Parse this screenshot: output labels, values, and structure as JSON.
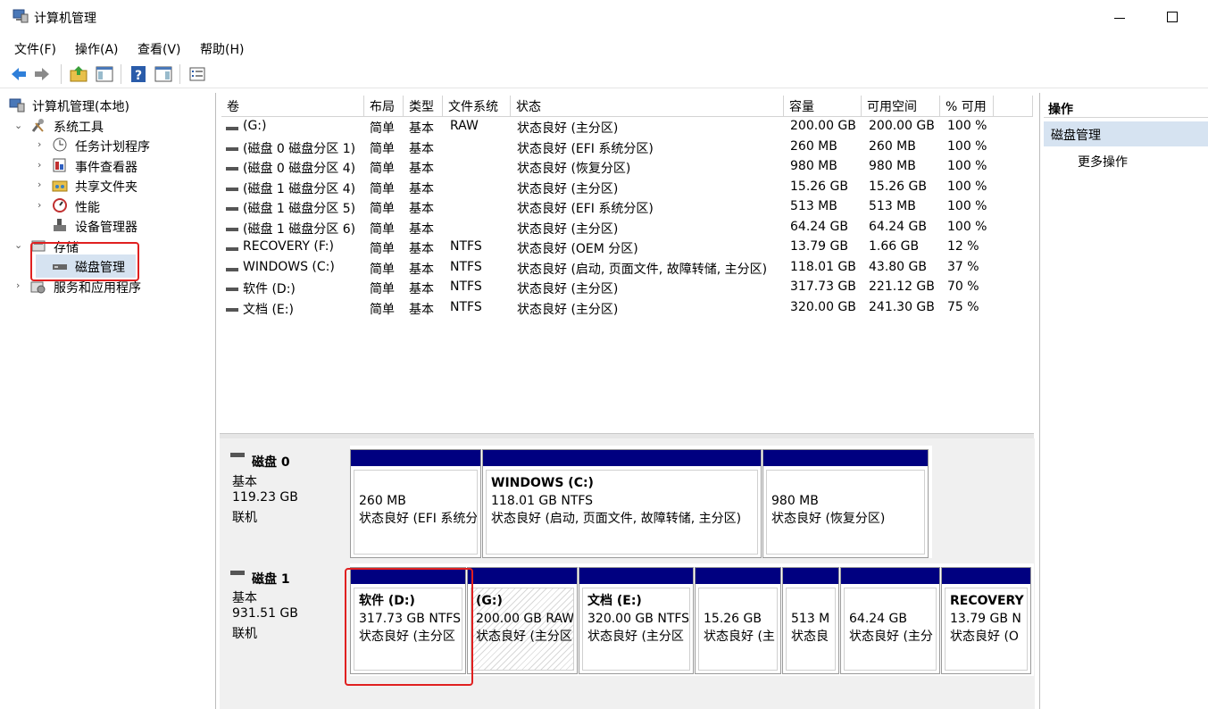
{
  "window": {
    "title": "计算机管理"
  },
  "menu": [
    "文件(F)",
    "操作(A)",
    "查看(V)",
    "帮助(H)"
  ],
  "toolbar": [
    "back-icon",
    "forward-icon",
    "up-folder-icon",
    "show-hide-tree-icon",
    "help-icon",
    "show-hide-action-pane-icon",
    "properties-icon"
  ],
  "tree": {
    "root": "计算机管理(本地)",
    "system_tools": "系统工具",
    "task_scheduler": "任务计划程序",
    "event_viewer": "事件查看器",
    "shared_folders": "共享文件夹",
    "performance": "性能",
    "device_manager": "设备管理器",
    "storage": "存储",
    "disk_management": "磁盘管理",
    "services_apps": "服务和应用程序"
  },
  "volume_table": {
    "headers": [
      "卷",
      "布局",
      "类型",
      "文件系统",
      "状态",
      "容量",
      "可用空间",
      "% 可用"
    ],
    "rows": [
      [
        "(G:)",
        "简单",
        "基本",
        "RAW",
        "状态良好 (主分区)",
        "200.00 GB",
        "200.00 GB",
        "100 %"
      ],
      [
        "(磁盘 0 磁盘分区 1)",
        "简单",
        "基本",
        "",
        "状态良好 (EFI 系统分区)",
        "260 MB",
        "260 MB",
        "100 %"
      ],
      [
        "(磁盘 0 磁盘分区 4)",
        "简单",
        "基本",
        "",
        "状态良好 (恢复分区)",
        "980 MB",
        "980 MB",
        "100 %"
      ],
      [
        "(磁盘 1 磁盘分区 4)",
        "简单",
        "基本",
        "",
        "状态良好 (主分区)",
        "15.26 GB",
        "15.26 GB",
        "100 %"
      ],
      [
        "(磁盘 1 磁盘分区 5)",
        "简单",
        "基本",
        "",
        "状态良好 (EFI 系统分区)",
        "513 MB",
        "513 MB",
        "100 %"
      ],
      [
        "(磁盘 1 磁盘分区 6)",
        "简单",
        "基本",
        "",
        "状态良好 (主分区)",
        "64.24 GB",
        "64.24 GB",
        "100 %"
      ],
      [
        "RECOVERY (F:)",
        "简单",
        "基本",
        "NTFS",
        "状态良好 (OEM 分区)",
        "13.79 GB",
        "1.66 GB",
        "12 %"
      ],
      [
        "WINDOWS (C:)",
        "简单",
        "基本",
        "NTFS",
        "状态良好 (启动, 页面文件, 故障转储, 主分区)",
        "118.01 GB",
        "43.80 GB",
        "37 %"
      ],
      [
        "软件 (D:)",
        "简单",
        "基本",
        "NTFS",
        "状态良好 (主分区)",
        "317.73 GB",
        "221.12 GB",
        "70 %"
      ],
      [
        "文档 (E:)",
        "简单",
        "基本",
        "NTFS",
        "状态良好 (主分区)",
        "320.00 GB",
        "241.30 GB",
        "75 %"
      ]
    ]
  },
  "disks": [
    {
      "name": "磁盘 0",
      "type": "基本",
      "size": "119.23 GB",
      "status": "联机",
      "partitions": [
        {
          "title": "",
          "line1": "260 MB",
          "line2": "状态良好 (EFI 系统分",
          "hatched": false
        },
        {
          "title": "WINDOWS  (C:)",
          "line1": "118.01 GB NTFS",
          "line2": "状态良好 (启动, 页面文件, 故障转储, 主分区)",
          "hatched": false
        },
        {
          "title": "",
          "line1": "980 MB",
          "line2": "状态良好 (恢复分区)",
          "hatched": false
        }
      ]
    },
    {
      "name": "磁盘 1",
      "type": "基本",
      "size": "931.51 GB",
      "status": "联机",
      "partitions": [
        {
          "title": "软件  (D:)",
          "line1": "317.73 GB NTFS",
          "line2": "状态良好 (主分区",
          "hatched": false
        },
        {
          "title": "(G:)",
          "line1": "200.00 GB RAW",
          "line2": "状态良好 (主分区",
          "hatched": true
        },
        {
          "title": "文档  (E:)",
          "line1": "320.00 GB NTFS",
          "line2": "状态良好 (主分区",
          "hatched": false
        },
        {
          "title": "",
          "line1": "15.26 GB",
          "line2": "状态良好 (主",
          "hatched": false
        },
        {
          "title": "",
          "line1": "513 M",
          "line2": "状态良",
          "hatched": false
        },
        {
          "title": "",
          "line1": "64.24 GB",
          "line2": "状态良好 (主分",
          "hatched": false
        },
        {
          "title": "RECOVERY",
          "line1": "13.79 GB N",
          "line2": "状态良好 (O",
          "hatched": false
        }
      ]
    }
  ],
  "actions": {
    "header": "操作",
    "disk_management": "磁盘管理",
    "more": "更多操作"
  },
  "colors": {
    "partition_bar": "#000080",
    "highlight": "#e02020",
    "selection": "#d6e3f1"
  }
}
